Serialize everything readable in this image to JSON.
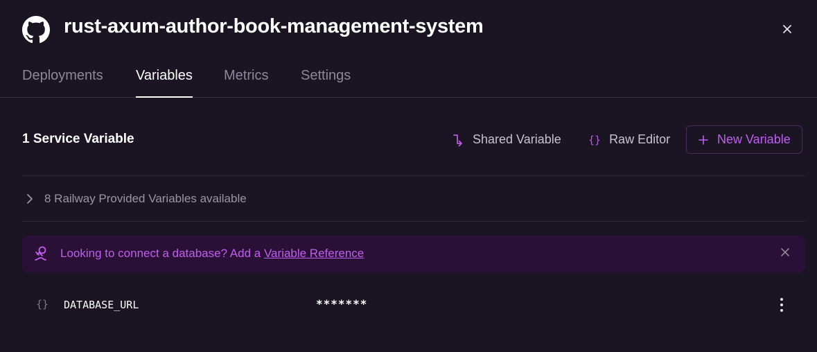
{
  "header": {
    "title": "rust-axum-author-book-management-system",
    "logo_icon": "github-icon",
    "close_icon": "close-icon"
  },
  "tabs": [
    {
      "label": "Deployments",
      "active": false
    },
    {
      "label": "Variables",
      "active": true
    },
    {
      "label": "Metrics",
      "active": false
    },
    {
      "label": "Settings",
      "active": false
    }
  ],
  "variables": {
    "title": "1 Service Variable",
    "actions": {
      "shared_label": "Shared Variable",
      "shared_icon": "shared-variable-icon",
      "raw_label": "Raw Editor",
      "raw_icon": "{}",
      "new_label": "New Variable",
      "new_icon": "plus-icon"
    },
    "provided": {
      "label": "8 Railway Provided Variables available",
      "icon": "chevron-right-icon"
    },
    "banner": {
      "text": "Looking to connect a database? Add a ",
      "link": "Variable Reference",
      "icon": "plug-icon"
    },
    "rows": [
      {
        "icon": "{}",
        "name": "DATABASE_URL",
        "value": "*******"
      }
    ]
  },
  "colors": {
    "background": "#1b1423",
    "accent": "#c05ef0",
    "banner_bg": "#2a0f37"
  }
}
